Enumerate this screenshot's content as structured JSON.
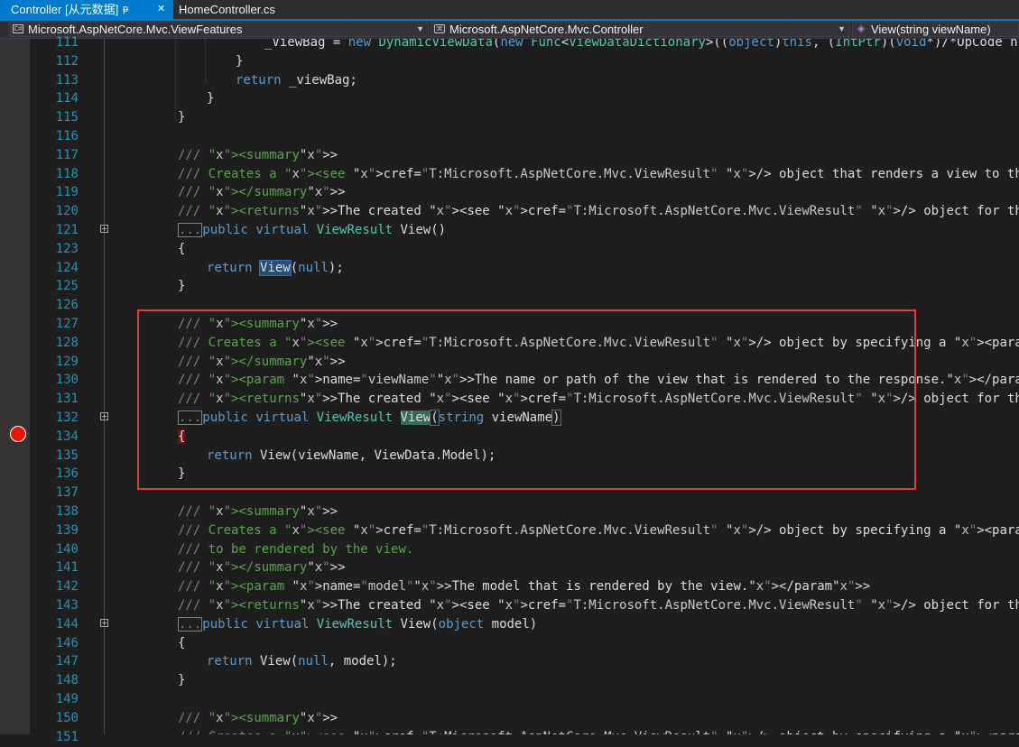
{
  "tabs": [
    {
      "label": "Controller [从元数据]",
      "pin": "ᵽ",
      "close": "✕",
      "active": true
    },
    {
      "label": "HomeController.cs",
      "active": false
    }
  ],
  "nav": {
    "project": "Microsoft.AspNetCore.Mvc.ViewFeatures",
    "type": "Microsoft.AspNetCore.Mvc.Controller",
    "member": "View(string viewName)"
  },
  "lines": [
    {
      "n": "111",
      "code": "_ViewBag = new DynamicViewData(new Func<ViewDataDictionary>((object)this, (IntPtr)(void*)/*OpCode n"
    },
    {
      "n": "112",
      "code": "}"
    },
    {
      "n": "113",
      "code": "return _viewBag;"
    },
    {
      "n": "114",
      "code": "}"
    },
    {
      "n": "115",
      "code": "}"
    },
    {
      "n": "116",
      "code": ""
    },
    {
      "n": "117",
      "code": "/// <summary>"
    },
    {
      "n": "118",
      "code": "/// Creates a <see cref=\"T:Microsoft.AspNetCore.Mvc.ViewResult\" /> object that renders a view to the response."
    },
    {
      "n": "119",
      "code": "/// </summary>"
    },
    {
      "n": "120",
      "code": "/// <returns>The created <see cref=\"T:Microsoft.AspNetCore.Mvc.ViewResult\" /> object for the response.</returns"
    },
    {
      "n": "121",
      "code": "...public virtual ViewResult View()"
    },
    {
      "n": "123",
      "code": "{"
    },
    {
      "n": "124",
      "code": "return View(null);"
    },
    {
      "n": "125",
      "code": "}"
    },
    {
      "n": "126",
      "code": ""
    },
    {
      "n": "127",
      "code": "/// <summary>"
    },
    {
      "n": "128",
      "code": "/// Creates a <see cref=\"T:Microsoft.AspNetCore.Mvc.ViewResult\" /> object by specifying a <paramref name=\"viewN"
    },
    {
      "n": "129",
      "code": "/// </summary>"
    },
    {
      "n": "130",
      "code": "/// <param name=\"viewName\">The name or path of the view that is rendered to the response.</param>"
    },
    {
      "n": "131",
      "code": "/// <returns>The created <see cref=\"T:Microsoft.AspNetCore.Mvc.ViewResult\" /> object for the response.</returns"
    },
    {
      "n": "132",
      "code": "...public virtual ViewResult View(string viewName)"
    },
    {
      "n": "134",
      "code": "{"
    },
    {
      "n": "135",
      "code": "return View(viewName, ViewData.Model);"
    },
    {
      "n": "136",
      "code": "}"
    },
    {
      "n": "137",
      "code": ""
    },
    {
      "n": "138",
      "code": "/// <summary>"
    },
    {
      "n": "139",
      "code": "/// Creates a <see cref=\"T:Microsoft.AspNetCore.Mvc.ViewResult\" /> object by specifying a <paramref name=\"model"
    },
    {
      "n": "140",
      "code": "/// to be rendered by the view."
    },
    {
      "n": "141",
      "code": "/// </summary>"
    },
    {
      "n": "142",
      "code": "/// <param name=\"model\">The model that is rendered by the view.</param>"
    },
    {
      "n": "143",
      "code": "/// <returns>The created <see cref=\"T:Microsoft.AspNetCore.Mvc.ViewResult\" /> object for the response.</returns"
    },
    {
      "n": "144",
      "code": "...public virtual ViewResult View(object model)"
    },
    {
      "n": "146",
      "code": "{"
    },
    {
      "n": "147",
      "code": "return View(null, model);"
    },
    {
      "n": "148",
      "code": "}"
    },
    {
      "n": "149",
      "code": ""
    },
    {
      "n": "150",
      "code": "/// <summary>"
    },
    {
      "n": "151",
      "code": "/// Creates a <see cref=\"T:Microsoft.AspNetCore.Mvc.ViewResult\" /> object by specifying a <paramref name=\"viewN"
    }
  ],
  "colors": {
    "accent": "#007acc",
    "highlight_box": "#e03a3a",
    "breakpoint": "#e51400"
  }
}
